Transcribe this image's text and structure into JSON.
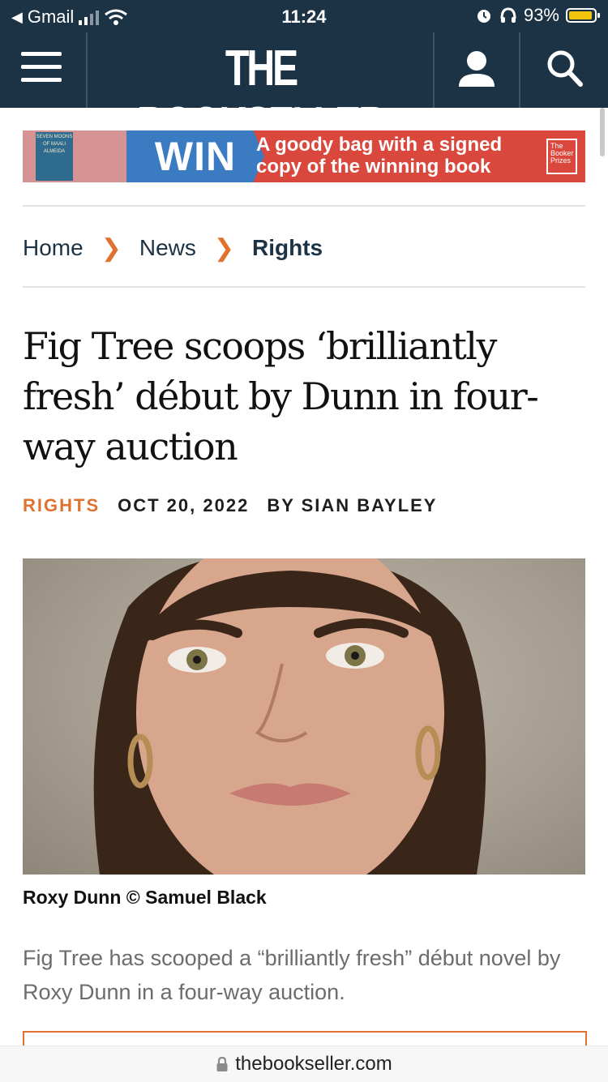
{
  "status_bar": {
    "back_app": "Gmail",
    "time": "11:24",
    "battery": "93%",
    "battery_level": 0.93,
    "signal_bars": 2
  },
  "header": {
    "logo": "THE BOOKSELLER",
    "background": "#1c3346"
  },
  "banner": {
    "book_cover_text": "SEVEN MOONS OF MAALI ALMEIDA",
    "win_label": "WIN",
    "message_line1": "A goody bag with a signed",
    "message_line2": "copy of the winning book",
    "prize_badge": "The Booker Prizes"
  },
  "breadcrumb": {
    "home": "Home",
    "news": "News",
    "current": "Rights"
  },
  "article": {
    "title": "Fig Tree scoops ‘brilliantly fresh’ début by Dunn in four-way auction",
    "category": "RIGHTS",
    "date": "OCT 20, 2022",
    "byline": "BY SIAN BAYLEY",
    "photo_caption": "Roxy Dunn © Samuel Black",
    "lede": "Fig Tree has scooped a “brilliantly fresh” début novel by Roxy Dunn in a four-way auction."
  },
  "url_bar": {
    "url": "thebookseller.com"
  },
  "colors": {
    "accent": "#e0722f",
    "navy": "#1c3346",
    "banner_red": "#d9473d",
    "banner_blue": "#3a7bc1"
  }
}
